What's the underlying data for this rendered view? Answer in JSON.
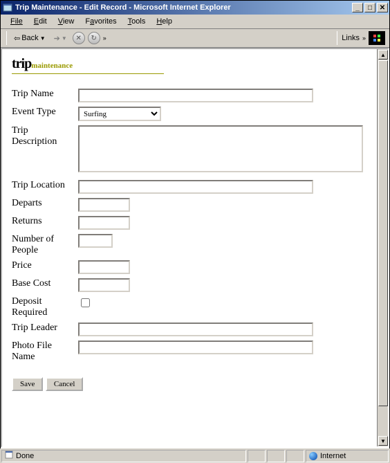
{
  "window": {
    "title": "Trip Maintenance - Edit Record - Microsoft Internet Explorer"
  },
  "menu": {
    "file": "File",
    "edit": "Edit",
    "view": "View",
    "favorites": "Favorites",
    "tools": "Tools",
    "help": "Help"
  },
  "toolbar": {
    "back": "Back",
    "links": "Links"
  },
  "logo": {
    "trip": "trip",
    "maintenance": "maintenance"
  },
  "labels": {
    "tripName": "Trip Name",
    "eventType": "Event Type",
    "tripDescription": "Trip Description",
    "tripLocation": "Trip Location",
    "departs": "Departs",
    "returns": "Returns",
    "numberOfPeople": "Number of People",
    "price": "Price",
    "baseCost": "Base Cost",
    "depositRequired": "Deposit Required",
    "tripLeader": "Trip Leader",
    "photoFileName": "Photo File Name"
  },
  "values": {
    "tripName": "",
    "eventType": "Surfing",
    "eventTypeOptions": [
      "Surfing"
    ],
    "tripDescription": "",
    "tripLocation": "",
    "departs": "",
    "returns": "",
    "numberOfPeople": "",
    "price": "",
    "baseCost": "",
    "depositRequired": false,
    "tripLeader": "",
    "photoFileName": ""
  },
  "buttons": {
    "save": "Save",
    "cancel": "Cancel"
  },
  "status": {
    "done": "Done",
    "zone": "Internet"
  }
}
